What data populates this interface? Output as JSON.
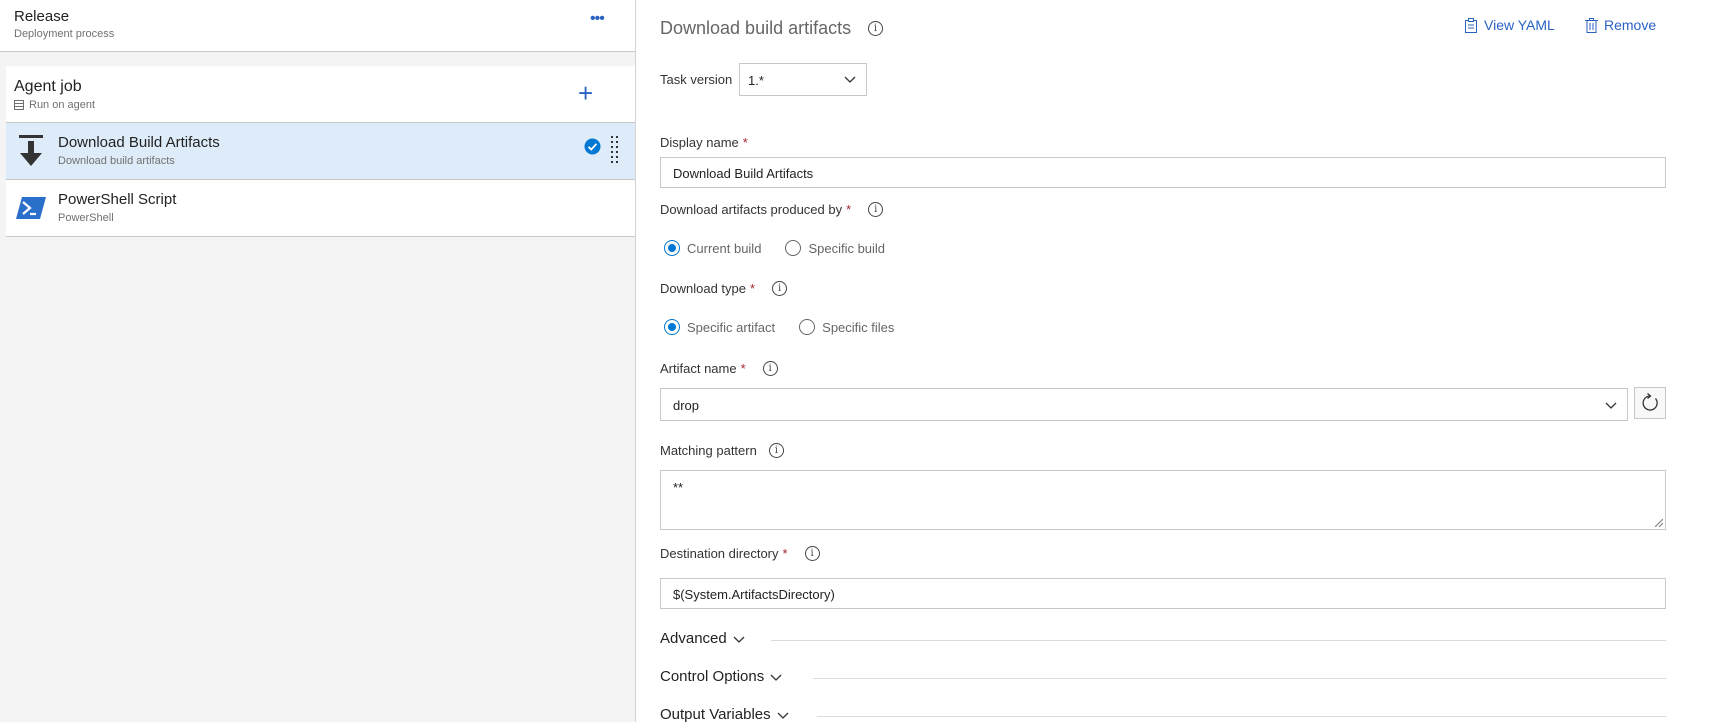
{
  "stage": {
    "title": "Release",
    "subtitle": "Deployment process"
  },
  "job": {
    "title": "Agent job",
    "subtitle": "Run on agent"
  },
  "tasks": [
    {
      "title": "Download Build Artifacts",
      "subtitle": "Download build artifacts"
    },
    {
      "title": "PowerShell Script",
      "subtitle": "PowerShell"
    }
  ],
  "panel": {
    "title": "Download build artifacts",
    "view_yaml": "View YAML",
    "remove": "Remove",
    "task_version_label": "Task version",
    "task_version_value": "1.*",
    "display_name_label": "Display name",
    "display_name_value": "Download Build Artifacts",
    "produced_by_label": "Download artifacts produced by",
    "produced_by_options": [
      "Current build",
      "Specific build"
    ],
    "download_type_label": "Download type",
    "download_type_options": [
      "Specific artifact",
      "Specific files"
    ],
    "artifact_name_label": "Artifact name",
    "artifact_name_value": "drop",
    "matching_pattern_label": "Matching pattern",
    "matching_pattern_value": "**",
    "destination_label": "Destination directory",
    "destination_value": "$(System.ArtifactsDirectory)",
    "sections": [
      "Advanced",
      "Control Options",
      "Output Variables"
    ]
  },
  "colors": {
    "accent": "#0078d4",
    "link": "#2b62c2",
    "required": "#a4262c",
    "selected_row": "#deecf9"
  }
}
